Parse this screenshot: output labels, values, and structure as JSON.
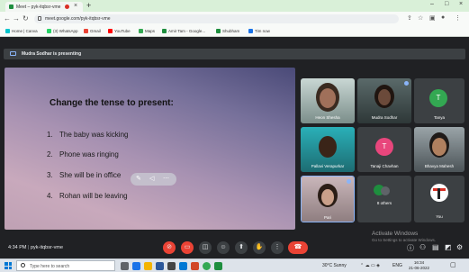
{
  "browser": {
    "tab_title": "Meet – pyk-itqbsr-vme",
    "url": "meet.google.com/pyk-itqbsr-vme",
    "bookmarks": [
      {
        "label": "Home | Canva",
        "color": "#00c4cc"
      },
      {
        "label": "(3) WhatsApp",
        "color": "#25d366"
      },
      {
        "label": "Gmail",
        "color": "#ea4335"
      },
      {
        "label": "YouTube",
        "color": "#ff0000"
      },
      {
        "label": "Maps",
        "color": "#34a853"
      },
      {
        "label": "Amir Tam - Google...",
        "color": "#1e8e3e"
      },
      {
        "label": "Shubham",
        "color": "#1e8e3e"
      },
      {
        "label": "Tim now",
        "color": "#1a73e8"
      }
    ]
  },
  "meet": {
    "presenting_label": "Mudra Sodhar is presenting",
    "slide": {
      "title": "Change the tense to present:",
      "items": [
        {
          "num": "1.",
          "text": "The baby was kicking"
        },
        {
          "num": "2.",
          "text": "Phone was ringing"
        },
        {
          "num": "3.",
          "text": "She will be in office"
        },
        {
          "num": "4.",
          "text": "Rohan will be leaving"
        }
      ]
    },
    "participants": [
      {
        "name": "Heon Shesha",
        "type": "video"
      },
      {
        "name": "Mudra Sodhar",
        "type": "video"
      },
      {
        "name": "Tanya",
        "type": "avatar",
        "initial": "T",
        "color": "#33a852"
      },
      {
        "name": "Pallavi Verapurkar",
        "type": "video"
      },
      {
        "name": "Tanaji Chavhan",
        "type": "avatar",
        "initial": "T",
        "color": "#e8467c"
      },
      {
        "name": "Bhavya Mahesh",
        "type": "video"
      },
      {
        "name": "Pari",
        "type": "video"
      },
      {
        "name": "8 others",
        "type": "others"
      },
      {
        "name": "You",
        "type": "self"
      }
    ],
    "meeting_time": "4:34 PM",
    "meeting_code": "pyk-itqbsr-vme",
    "activate_title": "Activate Windows",
    "activate_sub": "Go to Settings to activate Windows."
  },
  "taskbar": {
    "search_placeholder": "Type here to search",
    "weather": "30°C  Sunny",
    "language": "ENG",
    "time": "16:34",
    "date": "21-06-2022"
  }
}
